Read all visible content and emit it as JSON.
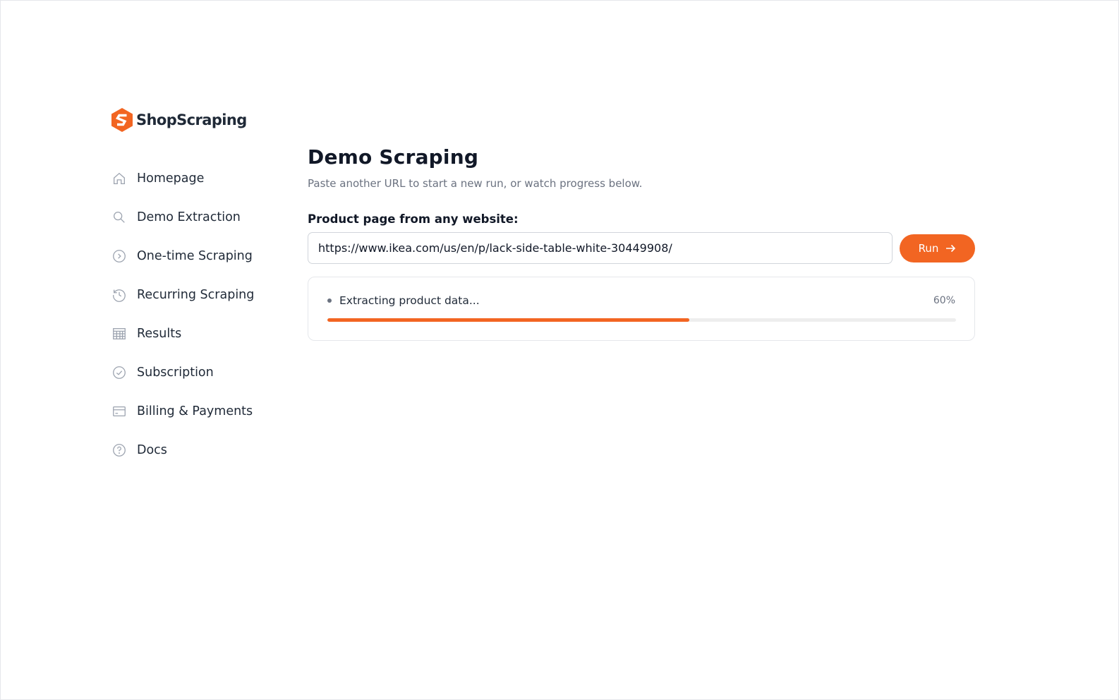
{
  "brand": {
    "name": "ShopScraping",
    "accent_color": "#f26522"
  },
  "sidebar": {
    "items": [
      {
        "label": "Homepage",
        "icon": "home-icon"
      },
      {
        "label": "Demo Extraction",
        "icon": "search-icon"
      },
      {
        "label": "One-time Scraping",
        "icon": "play-circle-icon"
      },
      {
        "label": "Recurring Scraping",
        "icon": "history-icon"
      },
      {
        "label": "Results",
        "icon": "table-icon"
      },
      {
        "label": "Subscription",
        "icon": "check-circle-icon"
      },
      {
        "label": "Billing & Payments",
        "icon": "credit-card-icon"
      },
      {
        "label": "Docs",
        "icon": "help-circle-icon"
      }
    ]
  },
  "main": {
    "title": "Demo Scraping",
    "subtitle": "Paste another URL to start a new run, or watch progress below.",
    "field_label": "Product page from any website:",
    "url_value": "https://www.ikea.com/us/en/p/lack-side-table-white-30449908/",
    "run_label": "Run",
    "run_icon": "arrow-right-icon",
    "progress": {
      "status": "Extracting product data...",
      "percent_label": "60%",
      "fraction": 0.576
    }
  }
}
